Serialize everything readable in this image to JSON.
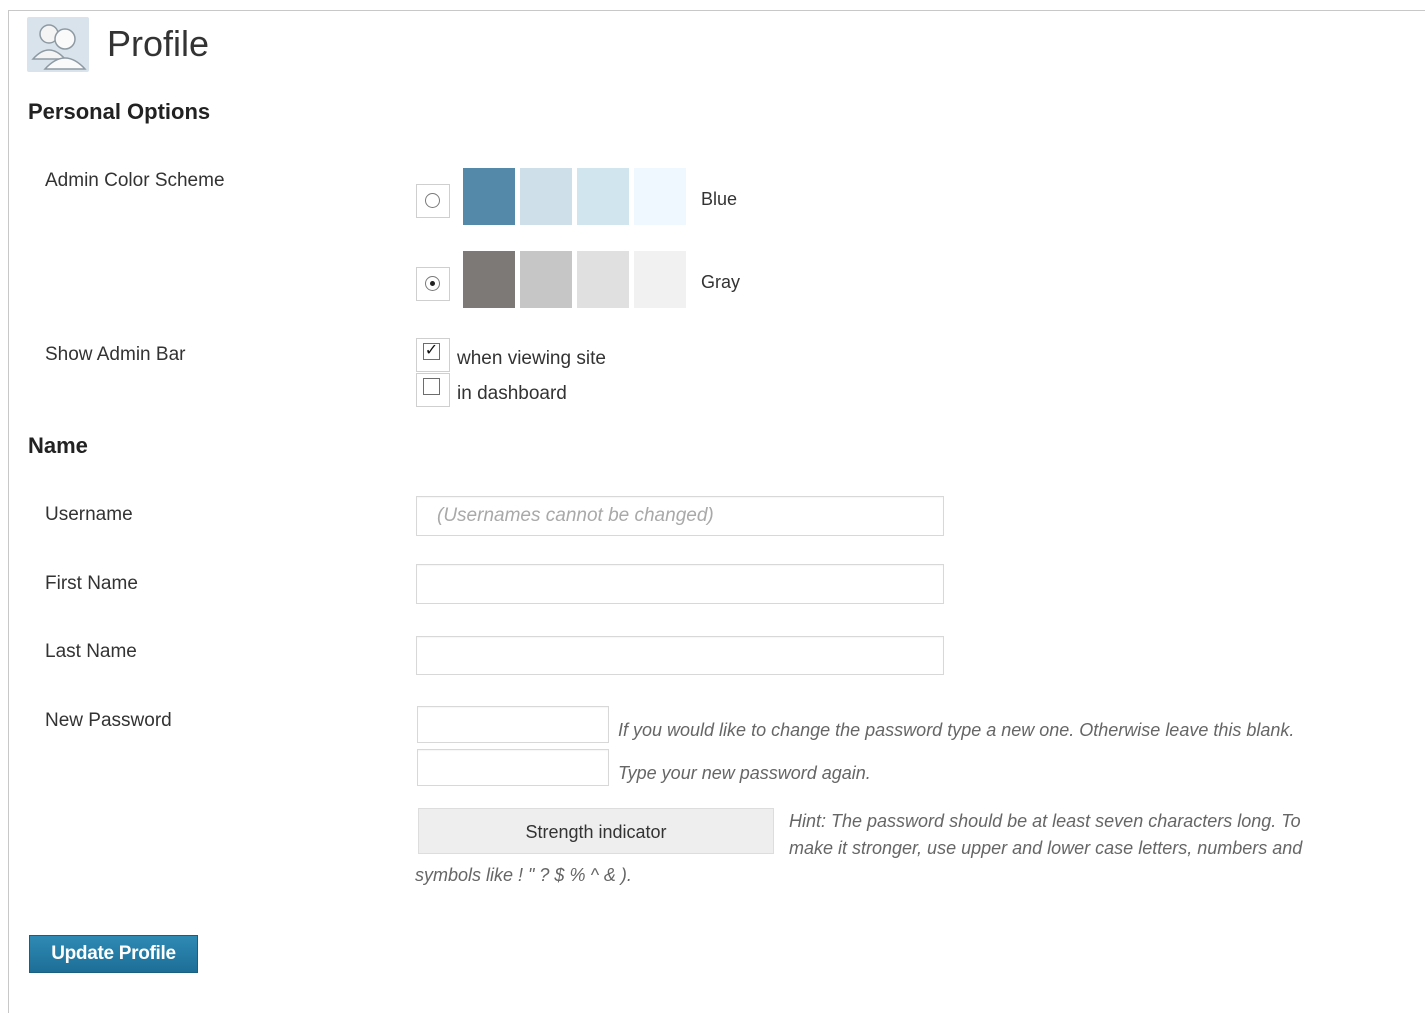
{
  "header": {
    "title": "Profile",
    "icon": "users-icon"
  },
  "personal_options": {
    "title": "Personal Options",
    "color_scheme": {
      "label": "Admin Color Scheme",
      "selected": "gray",
      "options": [
        {
          "id": "blue",
          "label": "Blue",
          "colors": [
            "#5589aa",
            "#cfdfe9",
            "#d1e5ee",
            "#eff8ff"
          ]
        },
        {
          "id": "gray",
          "label": "Gray",
          "colors": [
            "#7c7976",
            "#c6c6c6",
            "#e0e0e0",
            "#f1f1f1"
          ]
        }
      ]
    },
    "admin_bar": {
      "label": "Show Admin Bar",
      "options": [
        {
          "label": "when viewing site",
          "checked": true
        },
        {
          "label": "in dashboard",
          "checked": false
        }
      ]
    }
  },
  "name": {
    "title": "Name",
    "username": {
      "label": "Username",
      "placeholder": "(Usernames cannot be changed)"
    },
    "first_name": {
      "label": "First Name",
      "value": ""
    },
    "last_name": {
      "label": "Last Name",
      "value": ""
    },
    "new_password": {
      "label": "New Password",
      "hint1": "If you would like to change the password type a new one. Otherwise leave this blank.",
      "hint2": "Type your new password again.",
      "strength_label": "Strength indicator",
      "hint3_line1": "Hint: The password should be at least seven characters long. To",
      "hint3_line2": "make it stronger, use upper and lower case letters, numbers and",
      "hint3_line3": "symbols like ! \" ? $ % ^ & )."
    }
  },
  "footer": {
    "update_label": "Update Profile"
  },
  "colors": {
    "button": "#2179a6",
    "border": "#d8d8d8"
  }
}
